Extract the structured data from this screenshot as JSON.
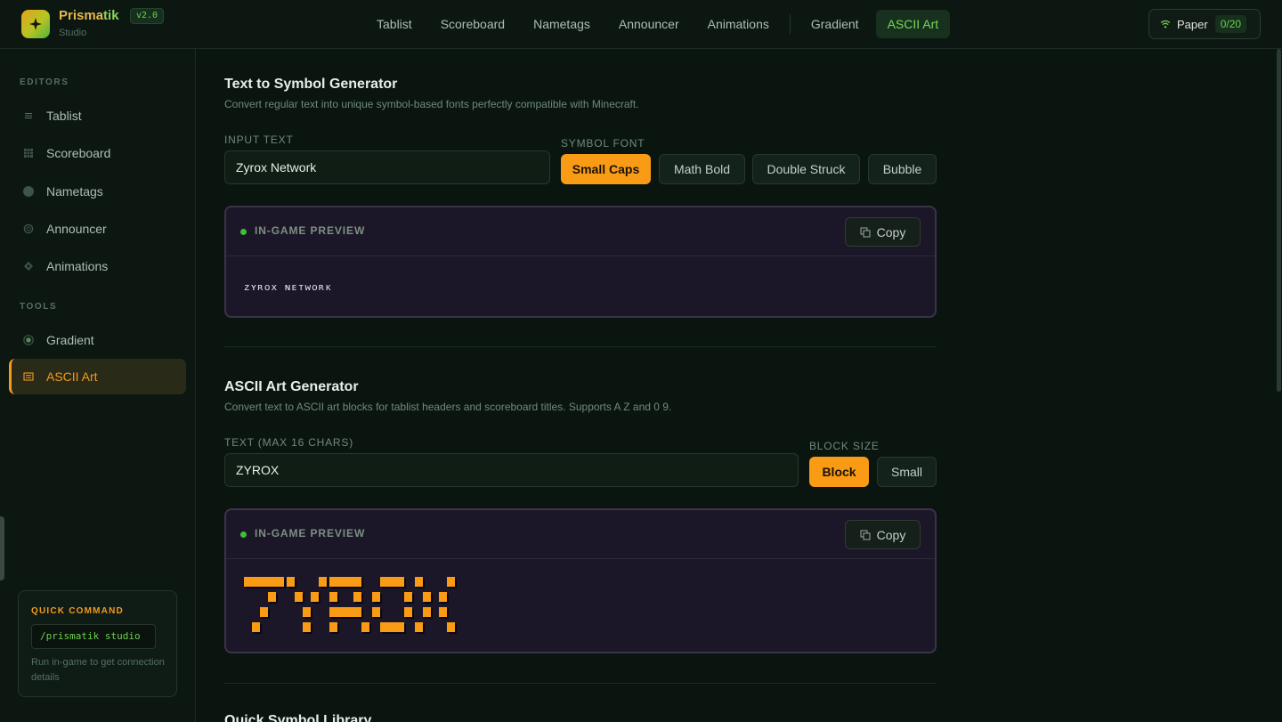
{
  "app": {
    "name_part1": "Prisma",
    "name_part2": "tik",
    "version": "v2.0",
    "subtitle": "Studio"
  },
  "topnav": [
    {
      "label": "Tablist"
    },
    {
      "label": "Scoreboard"
    },
    {
      "label": "Nametags"
    },
    {
      "label": "Announcer"
    },
    {
      "label": "Animations"
    },
    {
      "label": "Gradient"
    },
    {
      "label": "ASCII Art",
      "active": true
    }
  ],
  "server": {
    "name": "Paper",
    "players": "0/20"
  },
  "sidebar": {
    "editors_heading": "EDITORS",
    "editors": [
      {
        "label": "Tablist",
        "icon": "list-icon"
      },
      {
        "label": "Scoreboard",
        "icon": "grid-icon"
      },
      {
        "label": "Nametags",
        "icon": "circle-icon"
      },
      {
        "label": "Announcer",
        "icon": "ring-icon"
      },
      {
        "label": "Animations",
        "icon": "diamond-icon"
      }
    ],
    "tools_heading": "TOOLS",
    "tools": [
      {
        "label": "Gradient",
        "icon": "target-icon"
      },
      {
        "label": "ASCII Art",
        "icon": "panel-icon",
        "active": true
      }
    ],
    "quick_command": {
      "heading": "QUICK COMMAND",
      "command": "/prismatik studio",
      "description": "Run in-game to get connection details"
    }
  },
  "symbol_generator": {
    "title": "Text to Symbol Generator",
    "description": "Convert regular text into unique symbol-based fonts perfectly compatible with Minecraft.",
    "input_label": "INPUT TEXT",
    "input_value": "Zyrox Network",
    "font_label": "SYMBOL FONT",
    "fonts": [
      {
        "label": "Small Caps",
        "active": true
      },
      {
        "label": "Math Bold"
      },
      {
        "label": "Double Struck"
      },
      {
        "label": "Bubble"
      }
    ],
    "preview_label": "IN-GAME PREVIEW",
    "copy_label": "Copy",
    "preview_text": "ᴢʏʀᴏx ɴᴇᴛᴡᴏʀᴋ"
  },
  "ascii_generator": {
    "title": "ASCII Art Generator",
    "description": "Convert text to ASCII art blocks for tablist headers and scoreboard titles. Supports A Z and 0 9.",
    "input_label": "TEXT (MAX 16 CHARS)",
    "input_value": "ZYROX",
    "size_label": "BLOCK SIZE",
    "sizes": [
      {
        "label": "Block",
        "active": true
      },
      {
        "label": "Small"
      }
    ],
    "preview_label": "IN-GAME PREVIEW",
    "copy_label": "Copy",
    "ascii_color": "#f99b15"
  },
  "library": {
    "title": "Quick Symbol Library"
  },
  "colors": {
    "accent_orange": "#f99b15",
    "accent_green": "#6ccf4e",
    "preview_bg": "#1c1728"
  }
}
